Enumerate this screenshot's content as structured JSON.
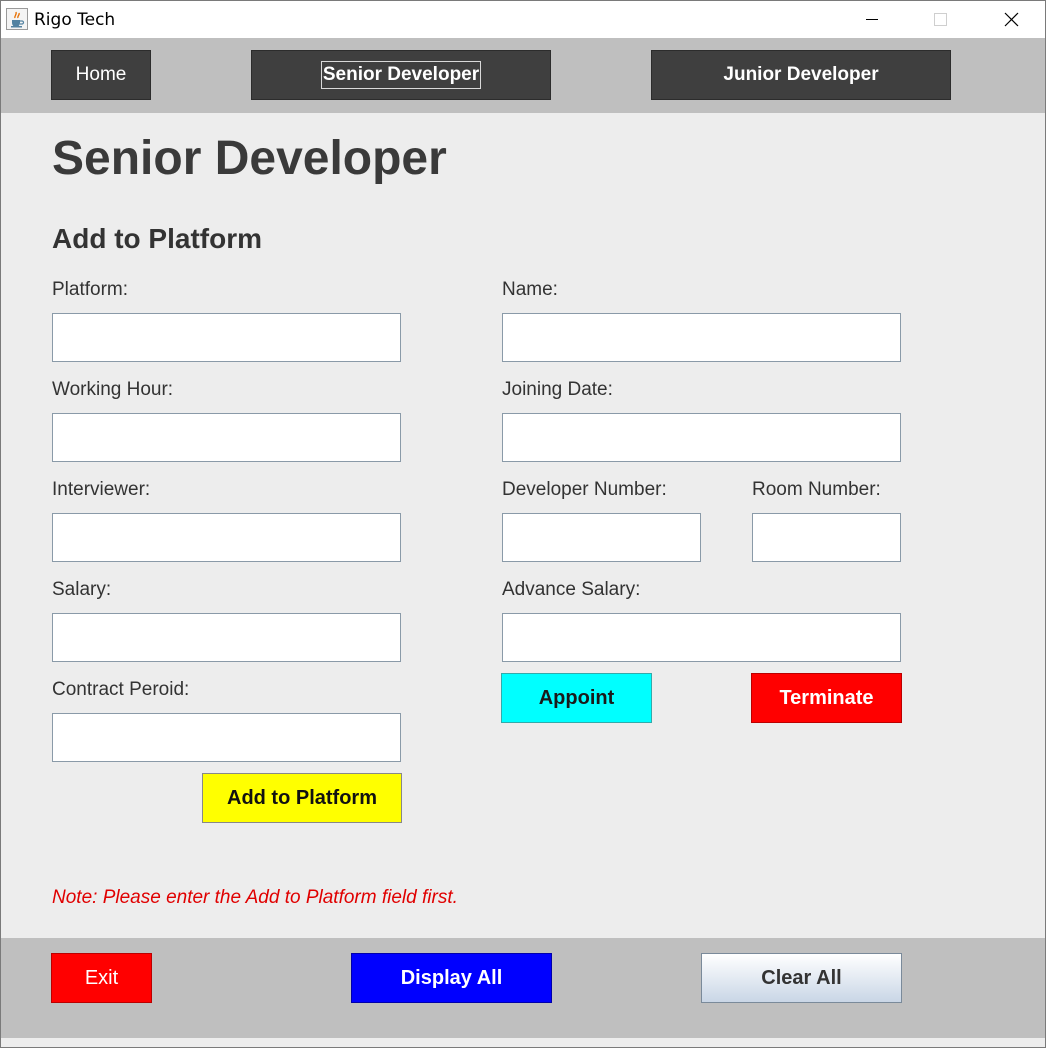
{
  "window": {
    "title": "Rigo Tech",
    "icons": {
      "app": "java-cup-icon",
      "minimize": "minimize-icon",
      "maximize": "maximize-icon",
      "close": "close-icon"
    }
  },
  "nav": {
    "home_label": "Home",
    "senior_label": "Senior Developer",
    "junior_label": "Junior Developer"
  },
  "page": {
    "title": "Senior Developer",
    "section_title": "Add to Platform"
  },
  "form": {
    "platform": {
      "label": "Platform:",
      "value": ""
    },
    "working_hour": {
      "label": "Working Hour:",
      "value": ""
    },
    "interviewer": {
      "label": "Interviewer:",
      "value": ""
    },
    "salary": {
      "label": "Salary:",
      "value": ""
    },
    "contract_period": {
      "label": "Contract Peroid:",
      "value": ""
    },
    "name": {
      "label": "Name:",
      "value": ""
    },
    "joining_date": {
      "label": "Joining Date:",
      "value": ""
    },
    "developer_number": {
      "label": "Developer Number:",
      "value": ""
    },
    "room_number": {
      "label": "Room Number:",
      "value": ""
    },
    "advance_salary": {
      "label": "Advance Salary:",
      "value": ""
    }
  },
  "buttons": {
    "appoint": "Appoint",
    "terminate": "Terminate",
    "add_to_platform": "Add to Platform",
    "exit": "Exit",
    "display_all": "Display All",
    "clear_all": "Clear All"
  },
  "note": "Note: Please enter the Add to Platform field first.",
  "colors": {
    "nav_button": "#3f3f3f",
    "bar": "#bfbfbf",
    "appoint": "#00ffff",
    "terminate": "#ff0000",
    "add": "#ffff00",
    "exit": "#ff0000",
    "display_all": "#0000ff",
    "note": "#e00000"
  }
}
